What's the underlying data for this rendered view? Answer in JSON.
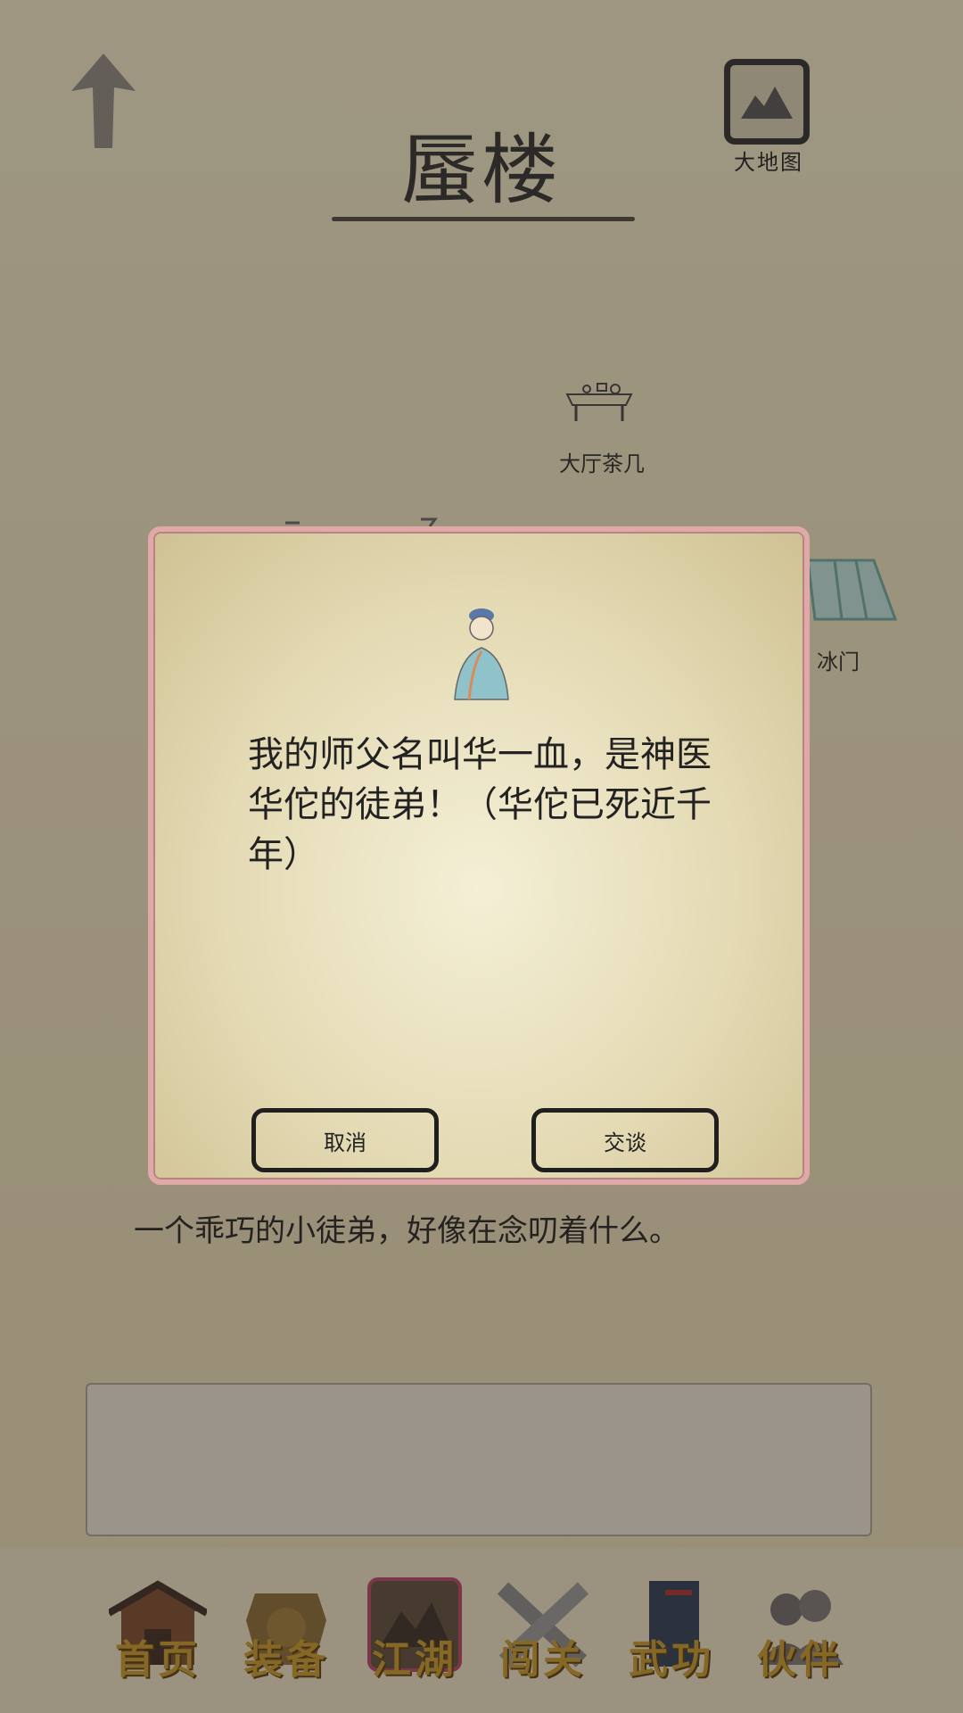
{
  "header": {
    "title": "蜃楼",
    "map_label": "大地图"
  },
  "scene_objects": [
    {
      "label": "大厅茶几",
      "icon": "tea-table-icon"
    },
    {
      "label": "冰门",
      "icon": "ice-door-icon"
    }
  ],
  "description": "一个乖巧的小徒弟，好像在念叨着什么。",
  "dialog": {
    "text": "我的师父名叫华一血，是神医华佗的徒弟！（华佗已死近千年）",
    "cancel_label": "取消",
    "talk_label": "交谈"
  },
  "bottom_nav": [
    {
      "label": "首页",
      "icon": "home-icon"
    },
    {
      "label": "装备",
      "icon": "armor-icon"
    },
    {
      "label": "江湖",
      "icon": "map-scroll-icon"
    },
    {
      "label": "闯关",
      "icon": "swords-icon"
    },
    {
      "label": "武功",
      "icon": "book-icon"
    },
    {
      "label": "伙伴",
      "icon": "partners-icon"
    }
  ],
  "colors": {
    "dialog_border": "#e0a9a7",
    "nav_label": "#c99a2a",
    "overlay": "rgba(40,36,30,0.42)"
  }
}
